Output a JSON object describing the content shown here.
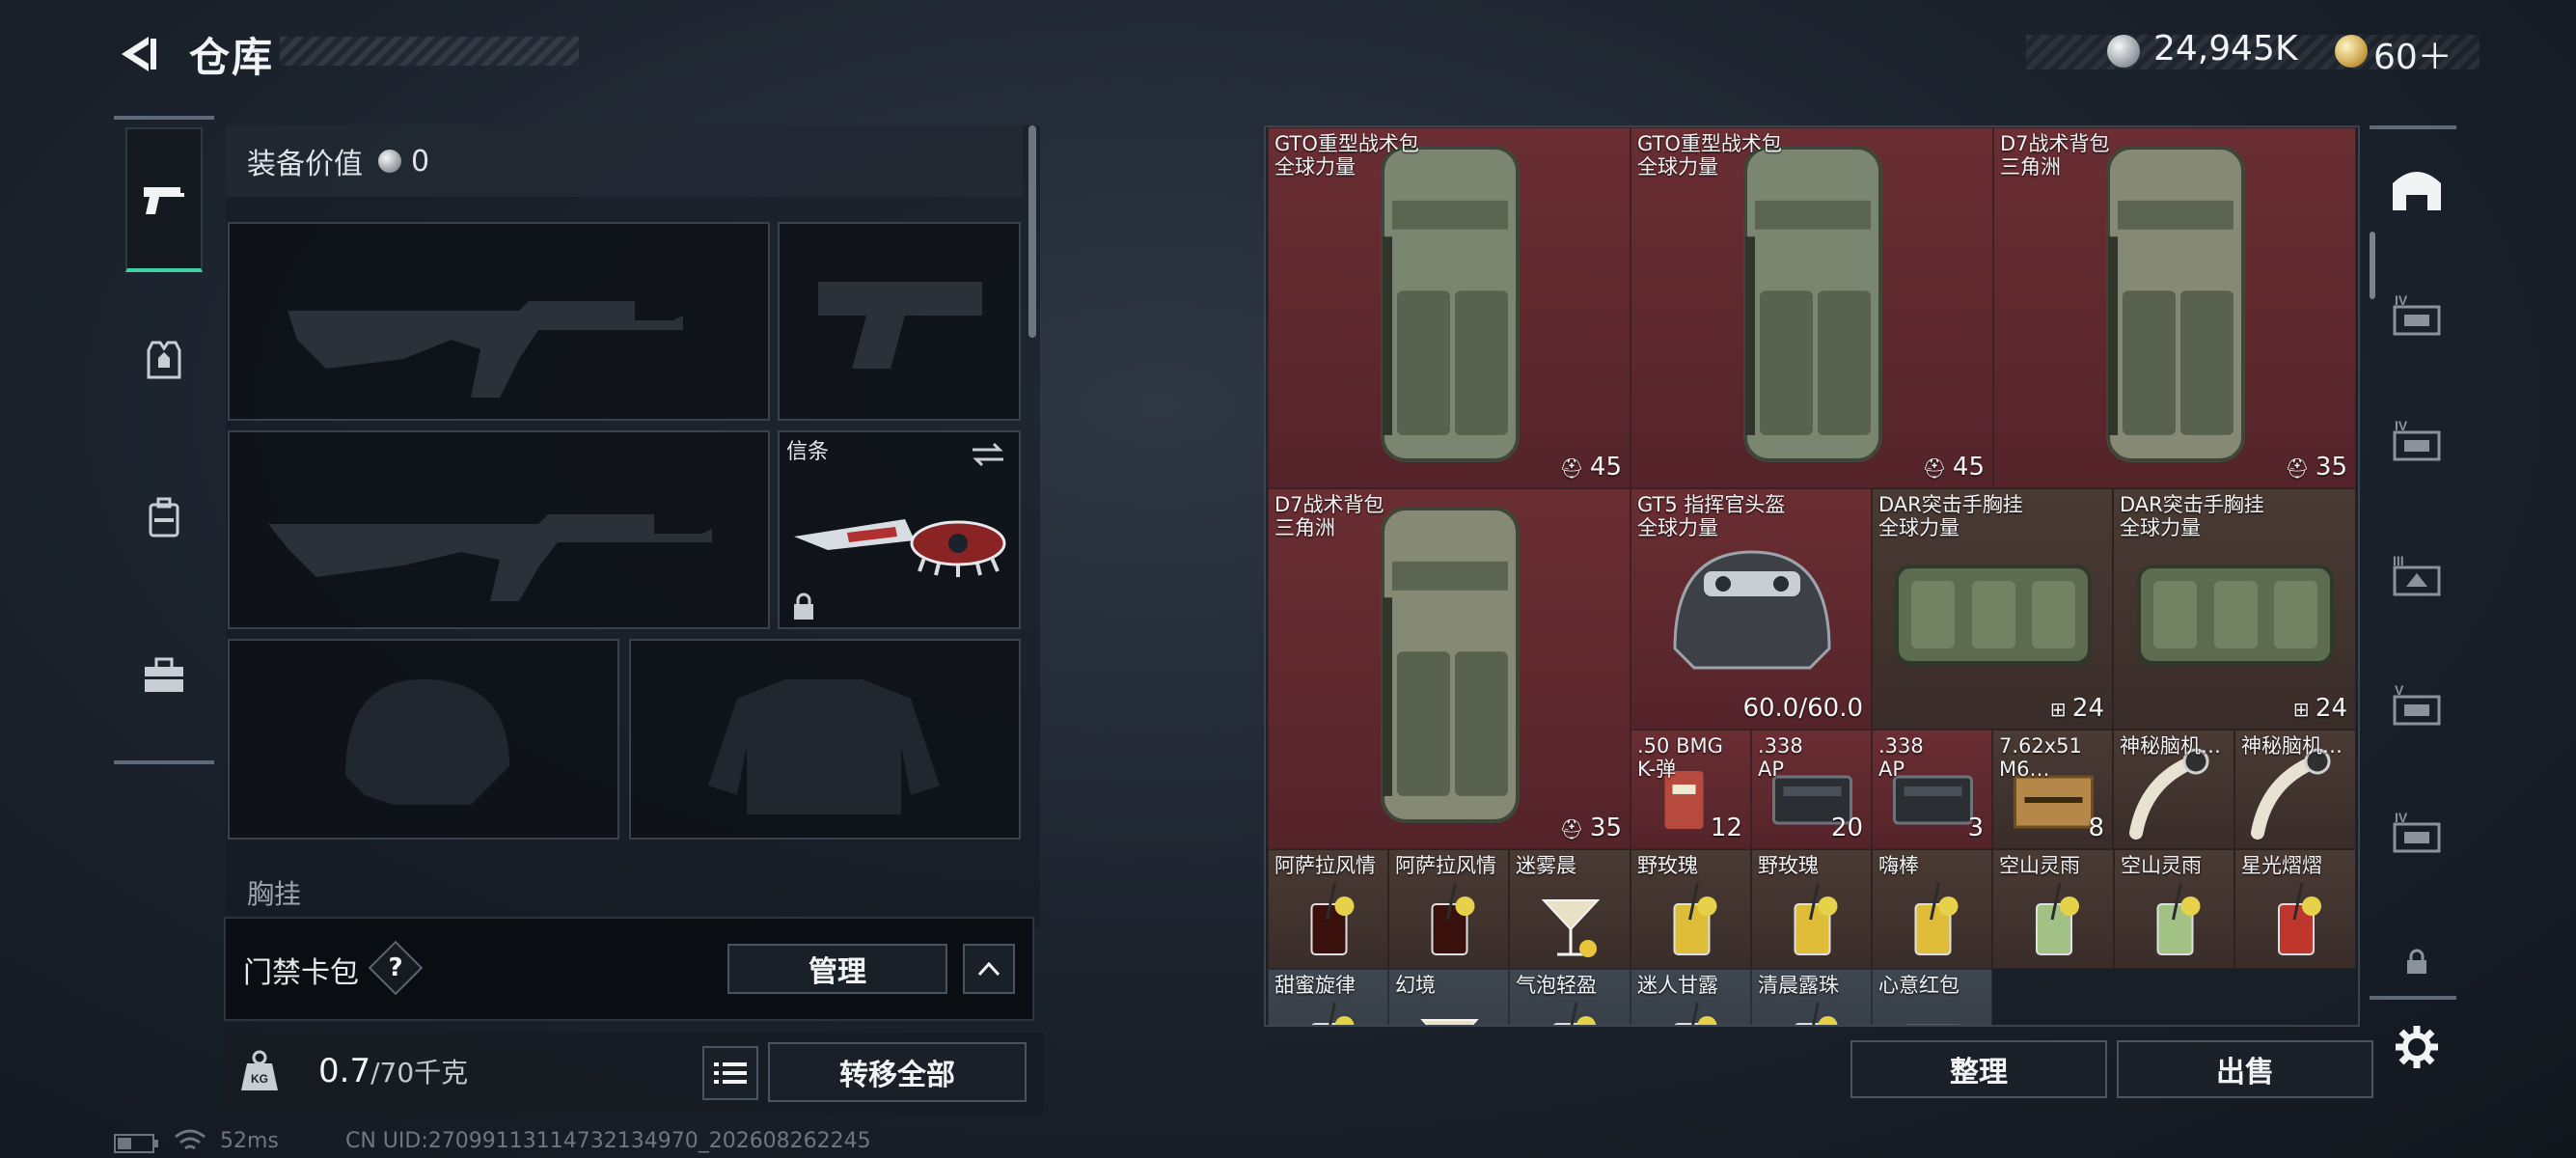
{
  "header": {
    "title": "仓库",
    "currency_silver": "24,945K",
    "currency_gold": "60＋"
  },
  "left_panel": {
    "value_label": "装备价值",
    "value_amount": "0",
    "knife_label": "信条",
    "chest_label": "胸挂",
    "card_label": "门禁卡包",
    "card_help": "?",
    "manage_button": "管理",
    "weight_value": "0.7",
    "weight_unit": "/70千克",
    "transfer_button": "转移全部"
  },
  "grid": {
    "items": [
      {
        "name": "GTO重型战术包\n全球力量",
        "count": "45",
        "bg": "#6a2e33"
      },
      {
        "name": "GTO重型战术包\n全球力量",
        "count": "45",
        "bg": "#6a2e33"
      },
      {
        "name": "D7战术背包\n三角洲",
        "count": "35",
        "bg": "#6a2e33"
      },
      {
        "name": "D7战术背包\n三角洲",
        "count": "35",
        "bg": "#6a2e33"
      },
      {
        "name": "GT5 指挥官头盔\n全球力量",
        "count": "60.0/60.0",
        "bg": "#6a2e33"
      },
      {
        "name": "DAR突击手胸挂\n全球力量",
        "count": "24",
        "bg": "#4a3a34"
      },
      {
        "name": "DAR突击手胸挂\n全球力量",
        "count": "24",
        "bg": "#4a3a34"
      },
      {
        "name": ".50 BMG\nK-弹",
        "count": "12",
        "bg": "#6a2e33"
      },
      {
        "name": ".338\nAP",
        "count": "20",
        "bg": "#6a2e33"
      },
      {
        "name": ".338\nAP",
        "count": "3",
        "bg": "#6a2e33"
      },
      {
        "name": "7.62x51\nM6…",
        "count": "8",
        "bg": "#4a3a34"
      },
      {
        "name": "神秘脑机…",
        "count": "",
        "bg": "#4a3a34"
      },
      {
        "name": "神秘脑机…",
        "count": "",
        "bg": "#4a3a34"
      },
      {
        "name": "阿萨拉风情",
        "count": "",
        "bg": "#4a3a34"
      },
      {
        "name": "阿萨拉风情",
        "count": "",
        "bg": "#4a3a34"
      },
      {
        "name": "迷雾晨",
        "count": "",
        "bg": "#4a3a34"
      },
      {
        "name": "野玫瑰",
        "count": "",
        "bg": "#4a3a34"
      },
      {
        "name": "野玫瑰",
        "count": "",
        "bg": "#4a3a34"
      },
      {
        "name": "嗨棒",
        "count": "",
        "bg": "#4a3a34"
      },
      {
        "name": "空山灵雨",
        "count": "",
        "bg": "#4a3a34"
      },
      {
        "name": "空山灵雨",
        "count": "",
        "bg": "#4a3a34"
      },
      {
        "name": "星光熠熠",
        "count": "",
        "bg": "#4a3a34"
      },
      {
        "name": "甜蜜旋律",
        "count": "",
        "bg": "#3e4650"
      },
      {
        "name": "幻境",
        "count": "",
        "bg": "#3e4650"
      },
      {
        "name": "气泡轻盈",
        "count": "",
        "bg": "#3e4650"
      },
      {
        "name": "迷人甘露",
        "count": "",
        "bg": "#3e4650"
      },
      {
        "name": "清晨露珠",
        "count": "",
        "bg": "#3e4650"
      },
      {
        "name": "心意红包",
        "count": "",
        "bg": "#3e4650"
      }
    ],
    "sort_button": "整理",
    "sell_button": "出售"
  },
  "status_bar": {
    "latency": "52ms",
    "uid": "CN UID:27099113114732134970_202608262245"
  },
  "colors": {
    "accent": "#3ed1a2",
    "cell_red": "#6a2e33",
    "cell_brown": "#4a3a34"
  }
}
